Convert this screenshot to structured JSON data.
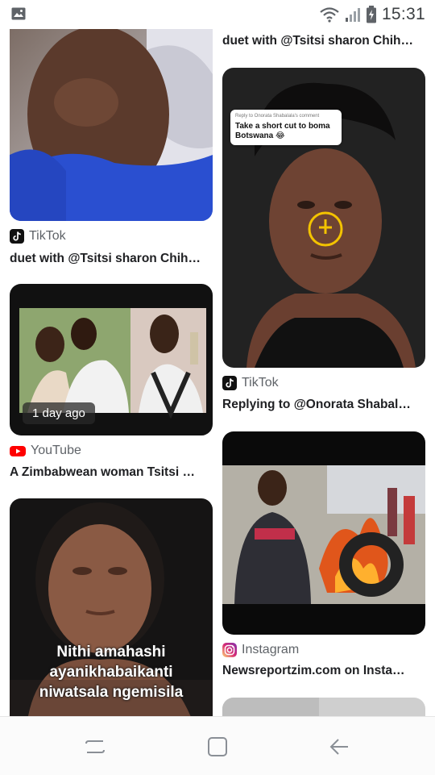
{
  "status_bar": {
    "time": "15:31"
  },
  "cards": [
    {
      "column": "left",
      "source": "TikTok",
      "source_icon": "tiktok-icon",
      "caption": "duet with @Tsitsi sharon Chih…"
    },
    {
      "column": "right",
      "source": "",
      "caption": "duet with @Tsitsi sharon Chih…"
    },
    {
      "column": "right",
      "source": "TikTok",
      "source_icon": "tiktok-icon",
      "caption": "Replying to @Onorata Shabal…",
      "comment_meta": "Reply to Onorata Shabalala's comment",
      "comment_text": "Take a short cut to boma Botswana 😂"
    },
    {
      "column": "left",
      "source": "YouTube",
      "source_icon": "youtube-icon",
      "caption": "A Zimbabwean woman Tsitsi …",
      "badge": "1 day ago"
    },
    {
      "column": "right",
      "source": "Instagram",
      "source_icon": "instagram-icon",
      "caption": "Newsreportzim.com on Insta…"
    },
    {
      "column": "left",
      "overlay_text": [
        "Nithi amahashi",
        "ayanikhabaikanti",
        "niwatsala ngemisila"
      ]
    }
  ],
  "colors": {
    "youtube": "#ff0000",
    "tiktok": "#111111",
    "instagram_start": "#feda75",
    "instagram_end": "#8134af"
  },
  "navbar": {
    "buttons": [
      "recent-apps",
      "home",
      "back"
    ]
  }
}
